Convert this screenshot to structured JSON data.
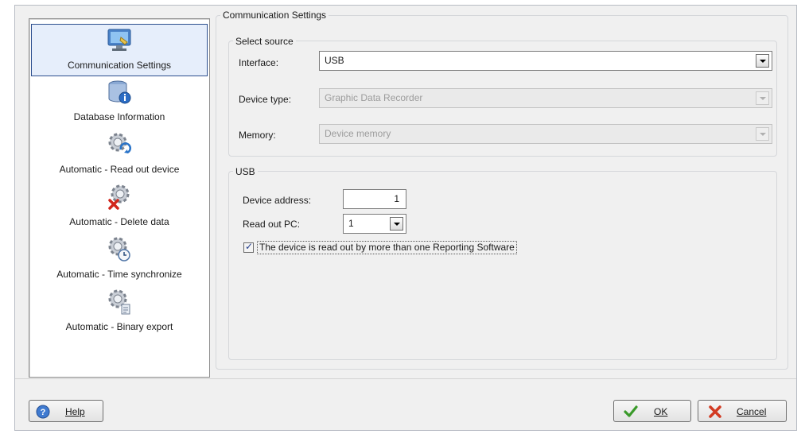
{
  "page_title": "Communication Settings",
  "nav": {
    "items": [
      {
        "label": "Communication Settings",
        "icon": "monitor-plug-icon",
        "selected": true
      },
      {
        "label": "Database Information",
        "icon": "database-info-icon",
        "selected": false
      },
      {
        "label": "Automatic - Read out device",
        "icon": "gear-refresh-icon",
        "selected": false
      },
      {
        "label": "Automatic - Delete data",
        "icon": "gear-delete-icon",
        "selected": false
      },
      {
        "label": "Automatic - Time synchronize",
        "icon": "gear-clock-icon",
        "selected": false
      },
      {
        "label": "Automatic - Binary export",
        "icon": "gear-export-icon",
        "selected": false
      }
    ]
  },
  "source_group": {
    "title": "Select source",
    "interface": {
      "label": "Interface:",
      "value": "USB"
    },
    "device_type": {
      "label": "Device type:",
      "value": "Graphic Data Recorder"
    },
    "memory": {
      "label": "Memory:",
      "value": "Device memory"
    }
  },
  "usb_group": {
    "title": "USB",
    "device_address": {
      "label": "Device address:",
      "value": "1"
    },
    "read_out_pc": {
      "label": "Read out PC:",
      "value": "1"
    },
    "multi_software": {
      "label": "The device is read out by more than one Reporting Software",
      "checked": true
    }
  },
  "footer": {
    "help": "Help",
    "ok": "OK",
    "cancel": "Cancel"
  },
  "colors": {
    "selection_border": "#2c4e8e",
    "selection_fill": "#e6eefb",
    "ok_check": "#3a9a2a",
    "cancel_x": "#d23a22"
  }
}
